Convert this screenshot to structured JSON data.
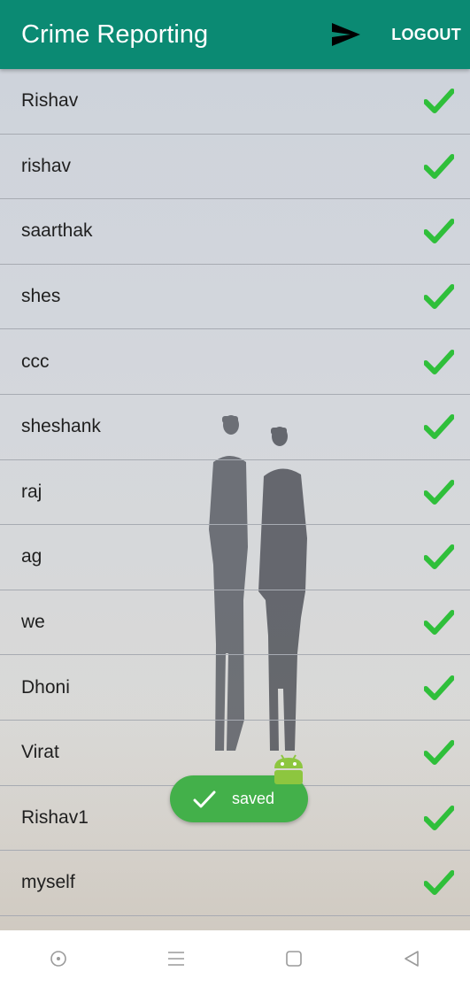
{
  "app": {
    "title": "Crime Reporting",
    "logout_label": "LOGOUT",
    "send_icon": "send-icon",
    "accent_color": "#0b8a73"
  },
  "list": {
    "items": [
      {
        "name": "Rishav",
        "status_icon": "check-icon"
      },
      {
        "name": "rishav",
        "status_icon": "check-icon"
      },
      {
        "name": "saarthak",
        "status_icon": "check-icon"
      },
      {
        "name": "shes",
        "status_icon": "check-icon"
      },
      {
        "name": "ccc",
        "status_icon": "check-icon"
      },
      {
        "name": "sheshank",
        "status_icon": "check-icon"
      },
      {
        "name": "raj",
        "status_icon": "check-icon"
      },
      {
        "name": "ag",
        "status_icon": "check-icon"
      },
      {
        "name": "we",
        "status_icon": "check-icon"
      },
      {
        "name": "Dhoni",
        "status_icon": "check-icon"
      },
      {
        "name": "Virat",
        "status_icon": "check-icon"
      },
      {
        "name": "Rishav1",
        "status_icon": "check-icon"
      },
      {
        "name": "myself",
        "status_icon": "check-icon"
      }
    ],
    "check_color": "#2fbf3a"
  },
  "toast": {
    "text": "saved",
    "color": "#43b04a"
  },
  "nav": {
    "buttons": [
      "circle-icon",
      "menu-icon",
      "home-square-icon",
      "back-triangle-icon"
    ]
  }
}
